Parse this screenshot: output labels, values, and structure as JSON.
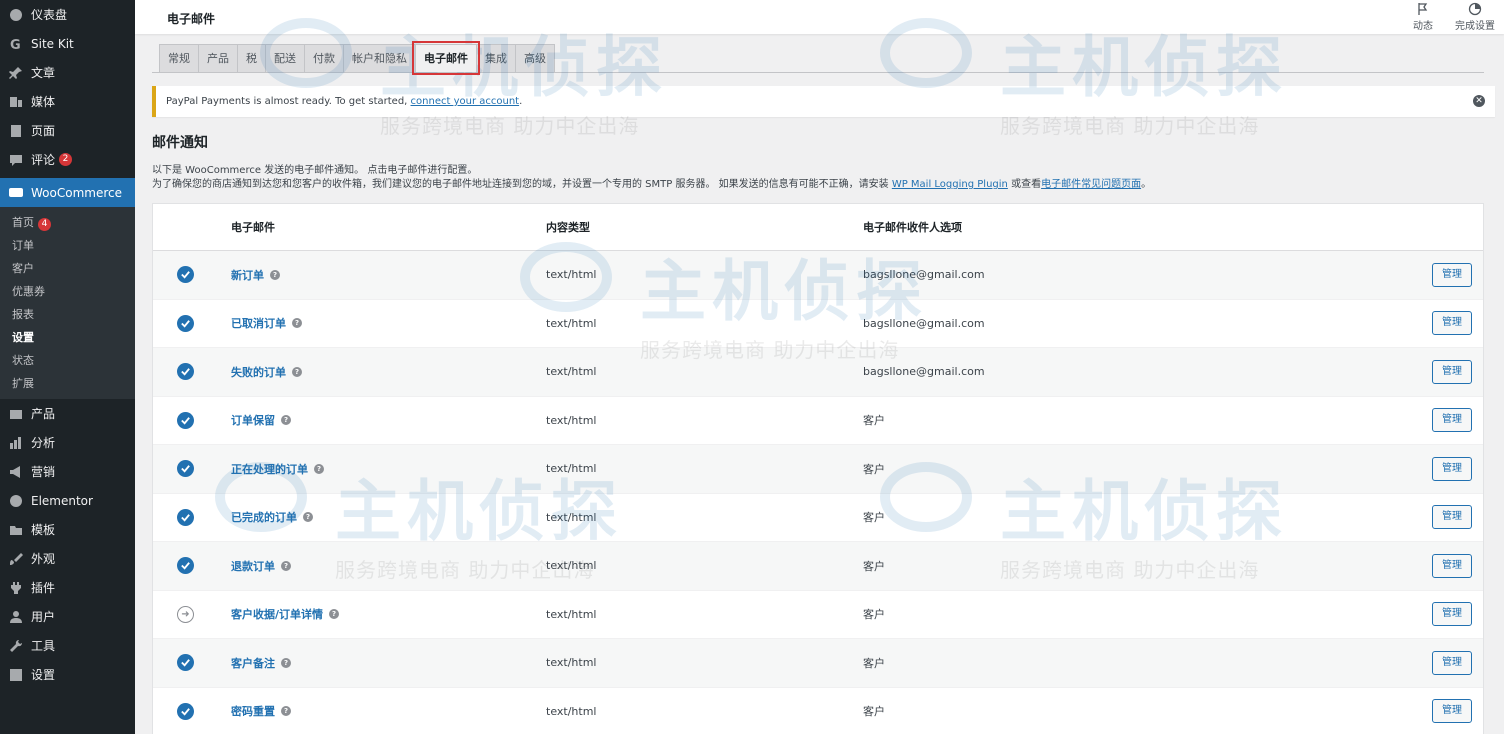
{
  "sidebar": {
    "items": [
      {
        "label": "仪表盘",
        "icon": "dashboard-icon"
      },
      {
        "label": "Site Kit",
        "icon": "sitekit-icon"
      },
      {
        "label": "文章",
        "icon": "pin-icon"
      },
      {
        "label": "媒体",
        "icon": "media-icon"
      },
      {
        "label": "页面",
        "icon": "page-icon"
      },
      {
        "label": "评论",
        "icon": "comment-icon",
        "badge": "2"
      },
      {
        "label": "WooCommerce",
        "icon": "woocommerce-icon",
        "active": true
      }
    ],
    "submenu": [
      {
        "label": "首页",
        "badge": "4"
      },
      {
        "label": "订单"
      },
      {
        "label": "客户"
      },
      {
        "label": "优惠券"
      },
      {
        "label": "报表"
      },
      {
        "label": "设置",
        "current": true
      },
      {
        "label": "状态"
      },
      {
        "label": "扩展"
      }
    ],
    "items_after": [
      {
        "label": "产品",
        "icon": "archive-icon"
      },
      {
        "label": "分析",
        "icon": "chart-icon"
      },
      {
        "label": "营销",
        "icon": "megaphone-icon"
      },
      {
        "label": "Elementor",
        "icon": "elementor-icon"
      },
      {
        "label": "模板",
        "icon": "folder-icon"
      },
      {
        "label": "外观",
        "icon": "brush-icon"
      },
      {
        "label": "插件",
        "icon": "plugin-icon"
      },
      {
        "label": "用户",
        "icon": "user-icon"
      },
      {
        "label": "工具",
        "icon": "wrench-icon"
      },
      {
        "label": "设置",
        "icon": "settings-icon"
      }
    ]
  },
  "topbar": {
    "title": "电子邮件",
    "activity_label": "动态",
    "setup_label": "完成设置"
  },
  "tabs": [
    {
      "label": "常规"
    },
    {
      "label": "产品"
    },
    {
      "label": "税"
    },
    {
      "label": "配送"
    },
    {
      "label": "付款"
    },
    {
      "label": "帐户和隐私"
    },
    {
      "label": "电子邮件",
      "active": true
    },
    {
      "label": "集成"
    },
    {
      "label": "高级"
    }
  ],
  "notice": {
    "text": "PayPal Payments is almost ready. To get started, ",
    "link": "connect your account",
    "end": "."
  },
  "section": {
    "heading": "邮件通知",
    "intro_line1": "以下是 WooCommerce 发送的电子邮件通知。 点击电子邮件进行配置。",
    "intro_line2_a": "为了确保您的商店通知到达您和您客户的收件箱，我们建议您的电子邮件地址连接到您的域，并设置一个专用的 SMTP 服务器。 如果发送的信息有可能不正确，请安装 ",
    "intro_link1": "WP Mail Logging Plugin",
    "intro_line2_b": " 或查看",
    "intro_link2": "电子邮件常见问题页面",
    "intro_line2_c": "。"
  },
  "table": {
    "headers": {
      "email": "电子邮件",
      "content_type": "内容类型",
      "recipient": "电子邮件收件人选项"
    },
    "rows": [
      {
        "name": "新订单",
        "type": "text/html",
        "recipient": "bagsllone@gmail.com",
        "status": "enabled",
        "action": "管理"
      },
      {
        "name": "已取消订单",
        "type": "text/html",
        "recipient": "bagsllone@gmail.com",
        "status": "enabled",
        "action": "管理"
      },
      {
        "name": "失败的订单",
        "type": "text/html",
        "recipient": "bagsllone@gmail.com",
        "status": "enabled",
        "action": "管理"
      },
      {
        "name": "订单保留",
        "type": "text/html",
        "recipient": "客户",
        "status": "enabled",
        "action": "管理"
      },
      {
        "name": "正在处理的订单",
        "type": "text/html",
        "recipient": "客户",
        "status": "enabled",
        "action": "管理"
      },
      {
        "name": "已完成的订单",
        "type": "text/html",
        "recipient": "客户",
        "status": "enabled",
        "action": "管理"
      },
      {
        "name": "退款订单",
        "type": "text/html",
        "recipient": "客户",
        "status": "enabled",
        "action": "管理"
      },
      {
        "name": "客户收据/订单详情",
        "type": "text/html",
        "recipient": "客户",
        "status": "manual",
        "action": "管理"
      },
      {
        "name": "客户备注",
        "type": "text/html",
        "recipient": "客户",
        "status": "enabled",
        "action": "管理"
      },
      {
        "name": "密码重置",
        "type": "text/html",
        "recipient": "客户",
        "status": "enabled",
        "action": "管理"
      }
    ]
  },
  "watermark": {
    "logo": "主机侦探",
    "sub": "服务跨境电商 助力中企出海"
  }
}
